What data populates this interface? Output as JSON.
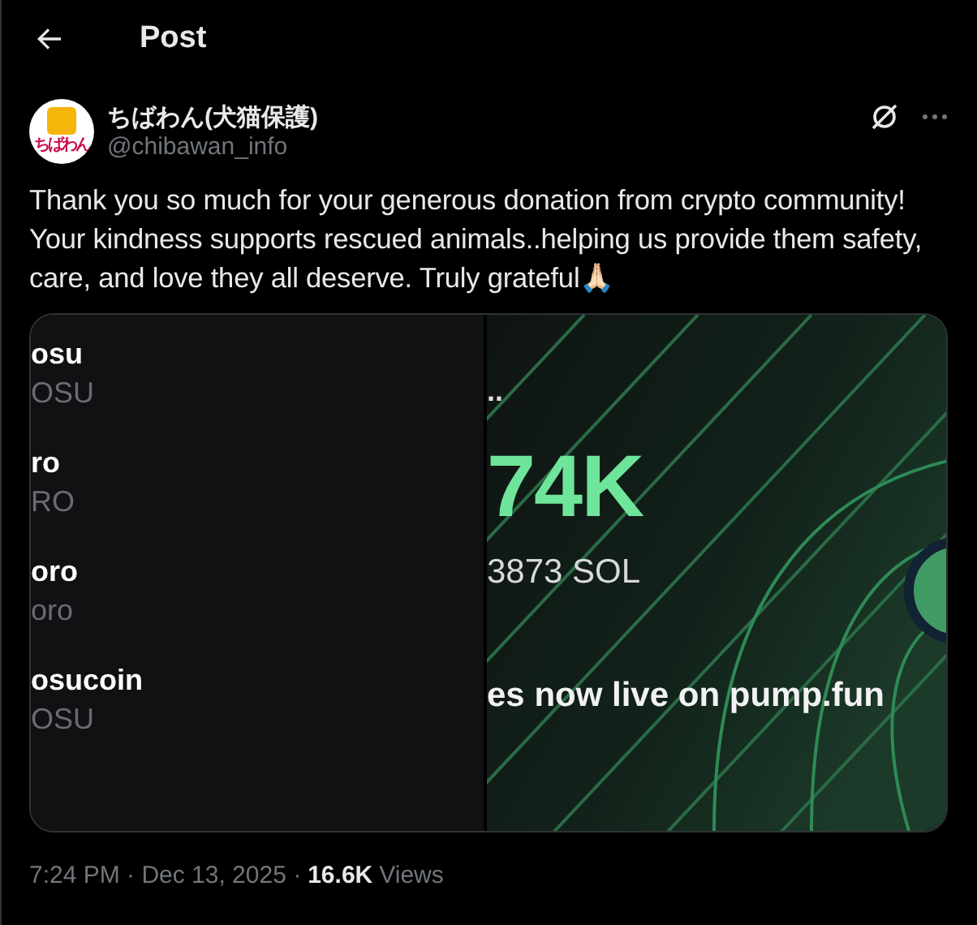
{
  "header": {
    "title": "Post"
  },
  "author": {
    "name": "ちばわん(犬猫保護)",
    "handle": "@chibawan_info",
    "avatar_label": "ちばわん"
  },
  "text": "Thank you so much for your generous donation from crypto community! Your kindness supports rescued animals..helping us provide them safety, care, and love they all deserve. Truly grateful🙏🏻",
  "media": {
    "list": [
      {
        "name": "osu",
        "ticker": "OSU"
      },
      {
        "name": "ro",
        "ticker": "RO"
      },
      {
        "name": "oro",
        "ticker": "oro"
      },
      {
        "name": "osucoin",
        "ticker": "OSU"
      }
    ],
    "ellipsis": "..",
    "amount": "74K",
    "sol": "3873 SOL",
    "caption": "es now live on pump.fun"
  },
  "meta": {
    "time": "7:24 PM · Dec 13, 2025 ·",
    "views_count": "16.6K",
    "views_label": "Views"
  }
}
